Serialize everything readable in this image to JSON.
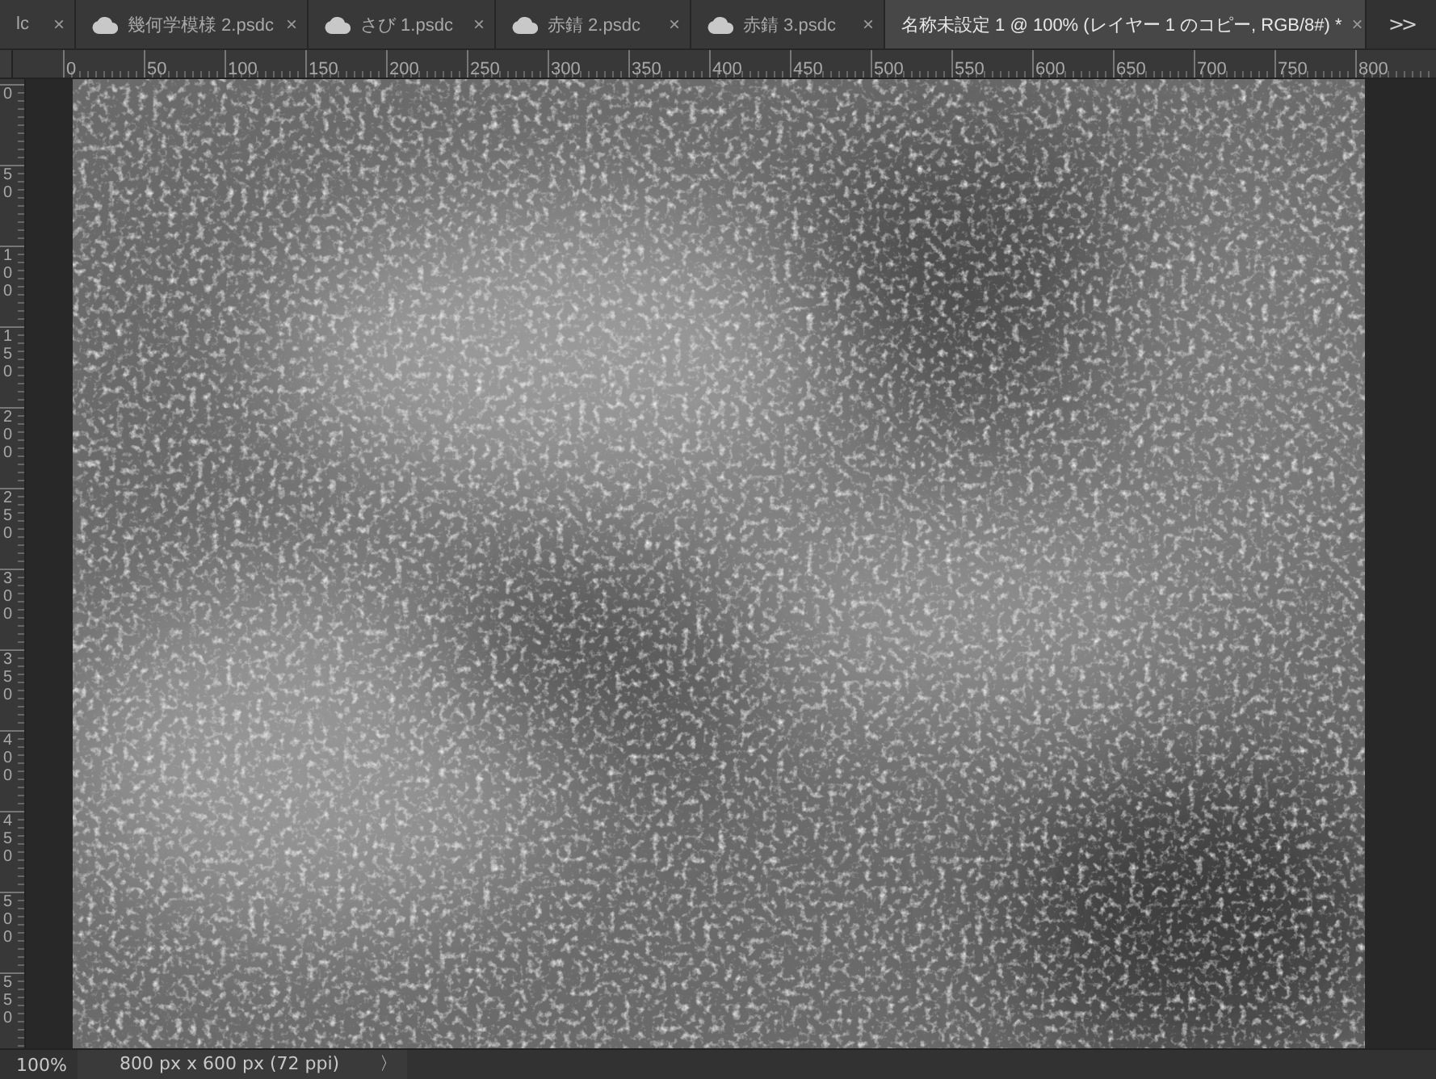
{
  "tabs": [
    {
      "label": "lc",
      "cloud": false,
      "selected": false,
      "close": "×"
    },
    {
      "label": "幾何学模様 2.psdc",
      "cloud": true,
      "selected": false,
      "close": "×"
    },
    {
      "label": "さび 1.psdc",
      "cloud": true,
      "selected": false,
      "close": "×"
    },
    {
      "label": "赤錆 2.psdc",
      "cloud": true,
      "selected": false,
      "close": "×"
    },
    {
      "label": "赤錆 3.psdc",
      "cloud": true,
      "selected": false,
      "close": "×"
    },
    {
      "label": "名称未設定 1 @ 100% (レイヤー 1 のコピー, RGB/8#) *",
      "cloud": false,
      "selected": true,
      "close": "×"
    }
  ],
  "tab_overflow": ">>",
  "horizontal_ruler": [
    "0",
    "50",
    "100",
    "150",
    "200",
    "250",
    "300",
    "350",
    "400",
    "450",
    "500",
    "550",
    "600",
    "650",
    "700",
    "750",
    "800"
  ],
  "vertical_ruler": [
    "0",
    "50",
    "100",
    "150",
    "200",
    "250",
    "300",
    "350",
    "400",
    "450",
    "500",
    "550"
  ],
  "status_bar": {
    "zoom": "100%",
    "document_size": "800 px x 600 px (72 ppi)",
    "menu": "〉"
  }
}
